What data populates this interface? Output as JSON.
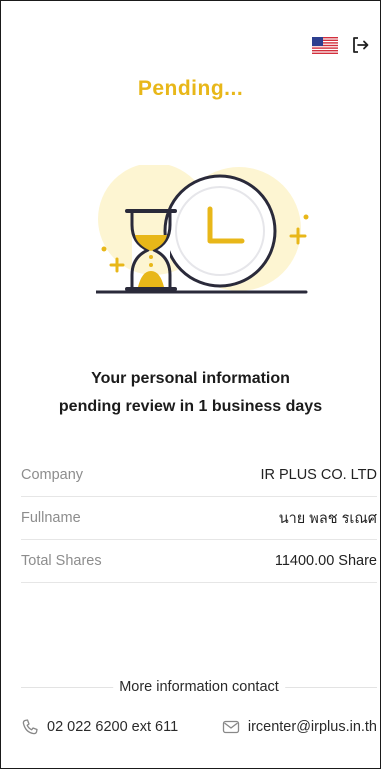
{
  "header": {
    "language_icon": "us-flag-icon",
    "logout_icon": "logout-icon"
  },
  "status": {
    "title": "Pending...",
    "color": "#e8b719"
  },
  "illustration": {
    "icons": [
      "hourglass-icon",
      "clock-icon",
      "sparkle-icon"
    ]
  },
  "message": {
    "line1": "Your personal information",
    "line2": "pending review in 1 business days"
  },
  "details": [
    {
      "label": "Company",
      "value": "IR PLUS CO. LTD"
    },
    {
      "label": "Fullname",
      "value": "นาย พลช รเณศ"
    },
    {
      "label": "Total Shares",
      "value": "11400.00 Share"
    }
  ],
  "contact": {
    "title": "More information contact",
    "phone": "02 022 6200 ext 611",
    "email": "ircenter@irplus.in.th"
  }
}
